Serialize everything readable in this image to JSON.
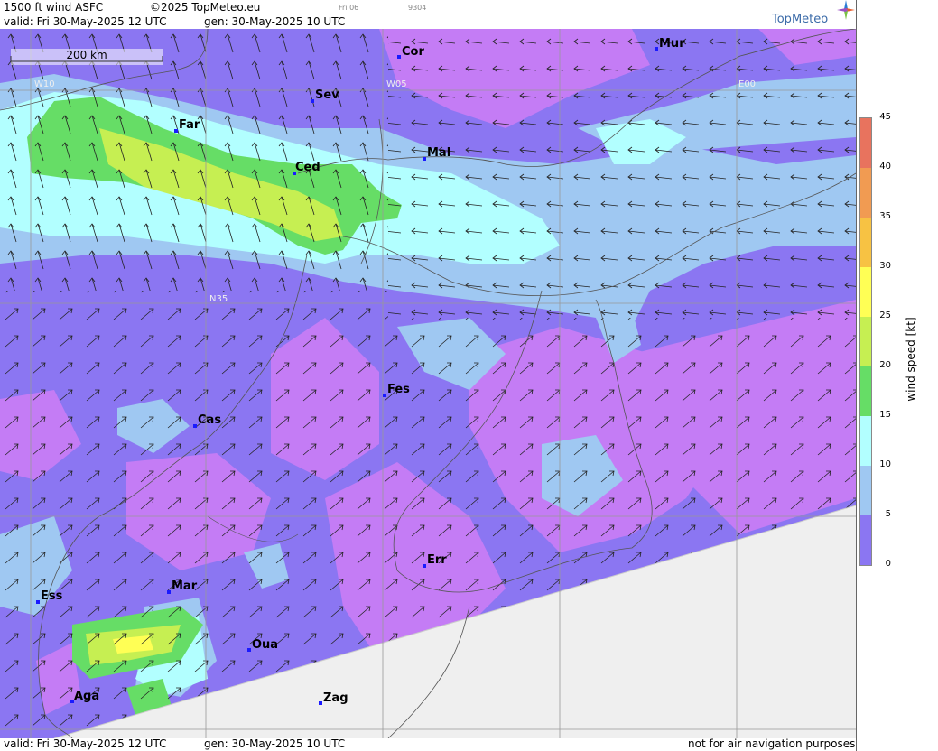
{
  "header": {
    "title": "1500 ft wind ASFC",
    "copyright": "©2025 TopMeteo.eu",
    "day_code": "Fri 06",
    "run_code": "9304",
    "valid": "valid:  Fri  30-May-2025  12 UTC",
    "generated": "gen: 30-May-2025 10 UTC",
    "logo": "TopMeteo"
  },
  "footer": {
    "valid": "valid:  Fri  30-May-2025  12 UTC",
    "generated": "gen: 30-May-2025 10 UTC",
    "disclaimer": "not for air navigation purposes"
  },
  "map": {
    "scale_label": "200 km",
    "grid_labels": [
      "W10",
      "W05",
      "E00",
      "N35"
    ],
    "cities": [
      {
        "id": "Cor",
        "name": "Cor"
      },
      {
        "id": "Mur",
        "name": "Mur"
      },
      {
        "id": "Sev",
        "name": "Sev"
      },
      {
        "id": "Far",
        "name": "Far"
      },
      {
        "id": "Mal",
        "name": "Mal"
      },
      {
        "id": "Ced",
        "name": "Ced"
      },
      {
        "id": "Fes",
        "name": "Fes"
      },
      {
        "id": "Cas",
        "name": "Cas"
      },
      {
        "id": "Err",
        "name": "Err"
      },
      {
        "id": "Ess",
        "name": "Ess"
      },
      {
        "id": "Mar",
        "name": "Mar"
      },
      {
        "id": "Oua",
        "name": "Oua"
      },
      {
        "id": "Aga",
        "name": "Aga"
      },
      {
        "id": "Zag",
        "name": "Zag"
      }
    ]
  },
  "legend": {
    "title": "wind  speed  [kt]",
    "ticks": [
      "45",
      "40",
      "35",
      "30",
      "25",
      "20",
      "15",
      "10",
      "5",
      "0"
    ],
    "colors": [
      "#e8735e",
      "#f19b52",
      "#f7c243",
      "#ffff55",
      "#c6ef52",
      "#66dd66",
      "#b2ffff",
      "#9fc8f2",
      "#8b76f2",
      "#c47cf5"
    ]
  }
}
